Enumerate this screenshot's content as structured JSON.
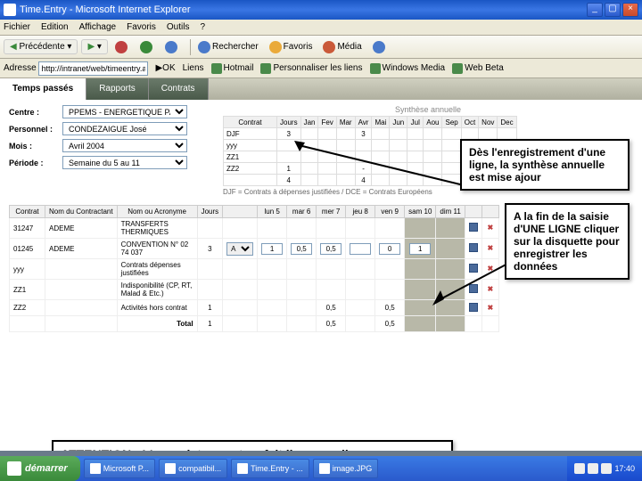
{
  "window": {
    "title": "Time.Entry - Microsoft Internet Explorer"
  },
  "menu": {
    "file": "Fichier",
    "edit": "Edition",
    "view": "Affichage",
    "fav": "Favoris",
    "tools": "Outils",
    "help": "?"
  },
  "toolbar": {
    "back": "Précédente",
    "search": "Rechercher",
    "favs": "Favoris",
    "media": "Média"
  },
  "address": {
    "label": "Adresse",
    "url": "http://intranet/web/timeentry.aspx",
    "go": "OK",
    "links": "Liens",
    "hotmail": "Hotmail",
    "perso": "Personnaliser les liens",
    "wmedia": "Windows Media",
    "wbeta": "Web Beta"
  },
  "tabs": {
    "t1": "Temps passés",
    "t2": "Rapports",
    "t3": "Contrats"
  },
  "form": {
    "centre_lbl": "Centre :",
    "centre": "PPEMS - ENERGETIQUE PARIS",
    "pers_lbl": "Personnel :",
    "pers": "CONDEZAIGUE José",
    "mois_lbl": "Mois :",
    "mois": "Avril 2004",
    "periode_lbl": "Période :",
    "periode": "Semaine du 5 au 11"
  },
  "synth": {
    "title": "Synthèse annuelle",
    "cols": [
      "Contrat",
      "Jours",
      "Jan",
      "Fev",
      "Mar",
      "Avr",
      "Mai",
      "Jun",
      "Jul",
      "Aou",
      "Sep",
      "Oct",
      "Nov",
      "Dec"
    ],
    "rows": [
      {
        "c": "DJF",
        "j": "3",
        "vals": [
          "",
          "",
          "",
          "3",
          "",
          "",
          "",
          "",
          "",
          "",
          "",
          ""
        ]
      },
      {
        "c": "yyy",
        "j": "",
        "vals": [
          "",
          "",
          "",
          "",
          "",
          "",
          "",
          "",
          "",
          "",
          "",
          ""
        ]
      },
      {
        "c": "ZZ1",
        "j": "",
        "vals": [
          "",
          "",
          "",
          "",
          "",
          "",
          "",
          "",
          "",
          "",
          "",
          ""
        ]
      },
      {
        "c": "ZZ2",
        "j": "1",
        "vals": [
          "",
          "",
          "",
          "-",
          "",
          "",
          "",
          "",
          "",
          "",
          "",
          ""
        ]
      },
      {
        "c": "",
        "j": "4",
        "vals": [
          "",
          "",
          "",
          "4",
          "",
          "",
          "",
          "",
          "",
          "",
          "",
          ""
        ]
      }
    ],
    "note": "DJF = Contrats à dépenses justifiées / DCE = Contrats Européens"
  },
  "entry": {
    "cols": {
      "contrat": "Contrat",
      "contractant": "Nom du Contractant",
      "acro": "Nom ou Acronyme",
      "jours": "Jours",
      "d1": "lun 5",
      "d2": "mar 6",
      "d3": "mer 7",
      "d4": "jeu 8",
      "d5": "ven 9",
      "d6": "sam 10",
      "d7": "dim 11"
    },
    "rows": [
      {
        "c": "31247",
        "ct": "ADEME",
        "ac": "TRANSFERTS THERMIQUES",
        "j": "",
        "v": [
          "",
          "",
          "",
          "",
          "",
          "",
          ""
        ]
      },
      {
        "c": "01245",
        "ct": "ADEME",
        "ac": "CONVENTION N° 02 74 037",
        "j": "3",
        "sel": "A",
        "v": [
          "1",
          "0,5",
          "0,5",
          "",
          "0",
          "1",
          ""
        ]
      },
      {
        "c": "yyy",
        "ct": "",
        "ac": "Contrats dépenses justifiées",
        "j": "",
        "v": [
          "",
          "",
          "",
          "",
          "",
          "",
          ""
        ]
      },
      {
        "c": "ZZ1",
        "ct": "",
        "ac": "Indisponibilité (CP, RT, Malad & Etc.)",
        "j": "",
        "v": [
          "",
          "",
          "",
          "",
          "",
          "",
          ""
        ]
      },
      {
        "c": "ZZ2",
        "ct": "",
        "ac": "Activités hors contrat",
        "j": "1",
        "v": [
          "",
          "",
          "0,5",
          "",
          "0,5",
          "",
          ""
        ]
      }
    ],
    "total_lbl": "Total",
    "total_j": "1",
    "totals": [
      "",
      "",
      "0,5",
      "",
      "0,5",
      "",
      ""
    ]
  },
  "callouts": {
    "c1": "Dès l'enregistrement d'une ligne, la synthèse annuelle est mise ajour",
    "c2": "A la fin de la saisie d'UNE LIGNE cliquer sur la disquette pour enregistrer les données",
    "c3": "ATTENTION : L'enregistrement se fait ligne par ligne"
  },
  "taskbar": {
    "start": "démarrer",
    "items": [
      "Microsoft P...",
      "compatibil...",
      "Time.Entry - ...",
      "image.JPG"
    ],
    "time": "17:40"
  }
}
